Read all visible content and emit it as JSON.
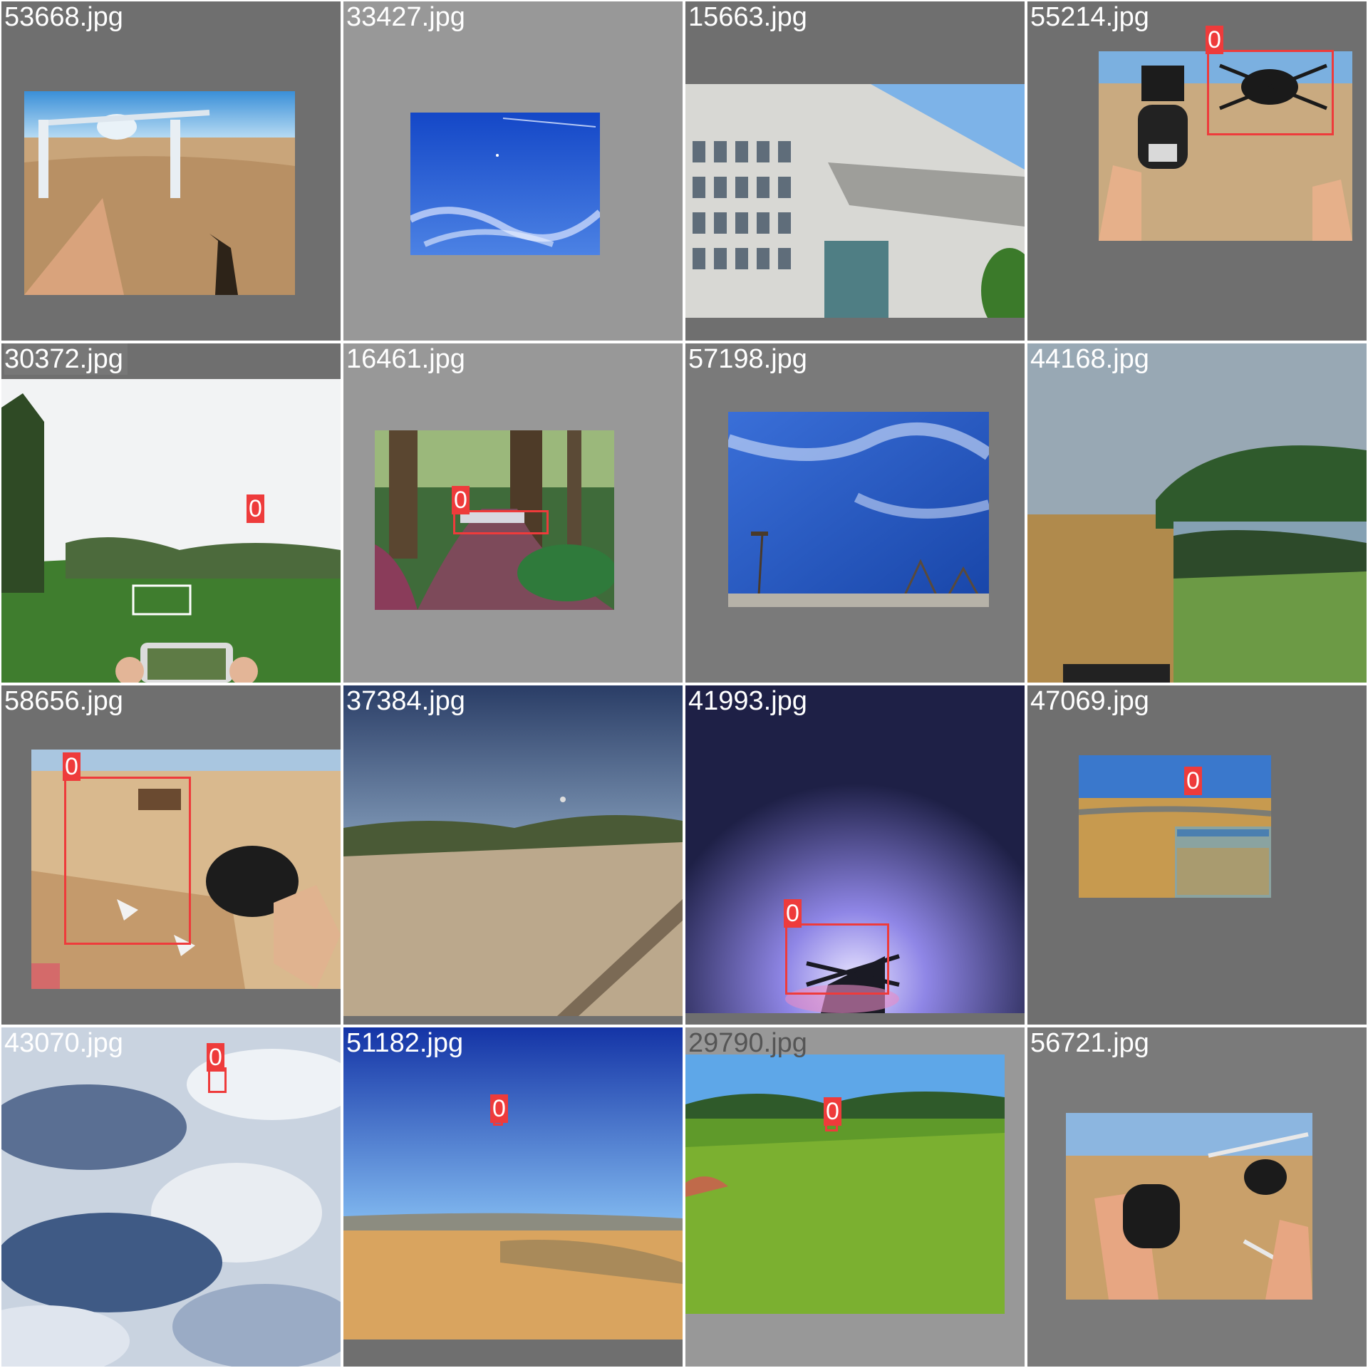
{
  "colors": {
    "box": "#ee3b3b",
    "tile_background_dark": "#6f6f6f",
    "tile_background_light": "#989898"
  },
  "tiles": [
    {
      "filename": "53668.jpg",
      "labels": []
    },
    {
      "filename": "33427.jpg",
      "labels": []
    },
    {
      "filename": "15663.jpg",
      "labels": []
    },
    {
      "filename": "55214.jpg",
      "labels": [
        "0"
      ]
    },
    {
      "filename": "30372.jpg",
      "labels": [
        "0"
      ]
    },
    {
      "filename": "16461.jpg",
      "labels": [
        "0"
      ]
    },
    {
      "filename": "57198.jpg",
      "labels": []
    },
    {
      "filename": "44168.jpg",
      "labels": []
    },
    {
      "filename": "58656.jpg",
      "labels": [
        "0"
      ]
    },
    {
      "filename": "37384.jpg",
      "labels": []
    },
    {
      "filename": "41993.jpg",
      "labels": [
        "0"
      ]
    },
    {
      "filename": "47069.jpg",
      "labels": [
        "0"
      ]
    },
    {
      "filename": "43070.jpg",
      "labels": [
        "0"
      ]
    },
    {
      "filename": "51182.jpg",
      "labels": [
        "0"
      ]
    },
    {
      "filename": "29790.jpg",
      "labels": [
        "0"
      ]
    },
    {
      "filename": "56721.jpg",
      "labels": []
    }
  ]
}
